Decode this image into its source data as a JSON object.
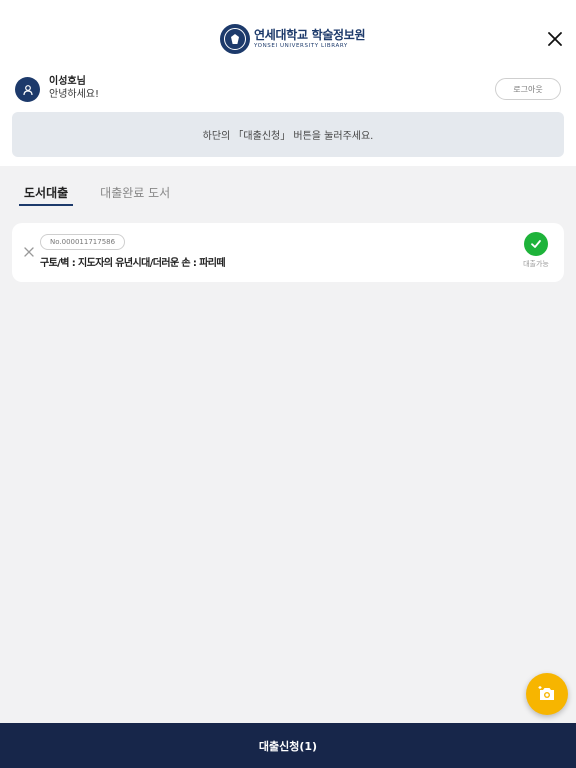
{
  "header": {
    "logo_ko": "연세대학교 학술정보원",
    "logo_en": "YONSEI UNIVERSITY LIBRARY",
    "close_icon": "close-icon"
  },
  "user": {
    "name": "이성호님",
    "greeting": "안녕하세요!",
    "logout_label": "로그아웃",
    "avatar_icon": "person-icon"
  },
  "notice": {
    "text": "하단의 「대출신청」 버튼을 눌러주세요."
  },
  "tabs": [
    {
      "label": "도서대출",
      "active": true
    },
    {
      "label": "대출완료 도서",
      "active": false
    }
  ],
  "books": [
    {
      "number": "No.000011717586",
      "title": "구토/벽 : 지도자의 유년시대/더러운 손 : 파리떼",
      "status": "대출가능"
    }
  ],
  "fab": {
    "icon": "camera-add-icon"
  },
  "bottom": {
    "label": "대출신청(1)"
  },
  "colors": {
    "brand": "#1d3a6b",
    "bottom_bar": "#17264a",
    "success": "#1eb33a",
    "fab": "#f7b500",
    "notice_bg": "#e5e9ee"
  }
}
